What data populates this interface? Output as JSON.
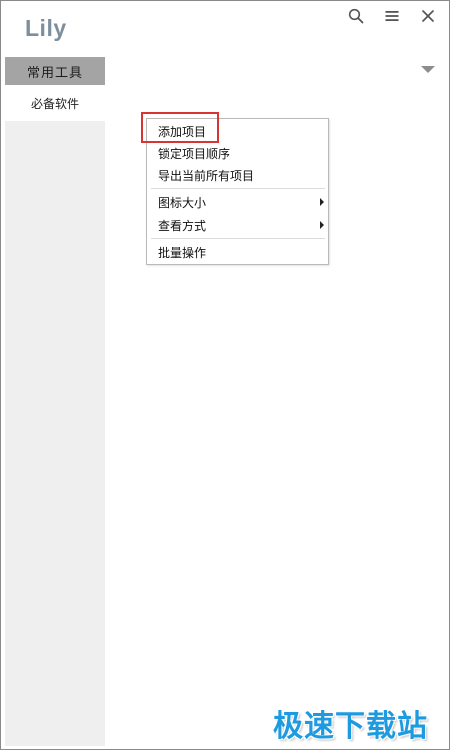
{
  "app": {
    "title": "Lily"
  },
  "header": {
    "icons": [
      "search-icon",
      "menu-icon",
      "close-icon"
    ]
  },
  "sidebar": {
    "category": "常用工具",
    "items": [
      {
        "label": "必备软件",
        "selected": true
      }
    ]
  },
  "context_menu": {
    "items": [
      {
        "label": "添加项目",
        "highlighted": true
      },
      {
        "label": "锁定项目顺序"
      },
      {
        "label": "导出当前所有项目"
      },
      {
        "label": "图标大小",
        "submenu": true
      },
      {
        "label": "查看方式",
        "submenu": true
      },
      {
        "label": "批量操作"
      }
    ]
  },
  "watermark": {
    "text": "极速下载站"
  },
  "colors": {
    "title": "#7d8f9c",
    "category_tab": "#a4a4a4",
    "sidebar": "#efefef",
    "highlight": "#d83434",
    "watermark": "#1e9be0"
  }
}
